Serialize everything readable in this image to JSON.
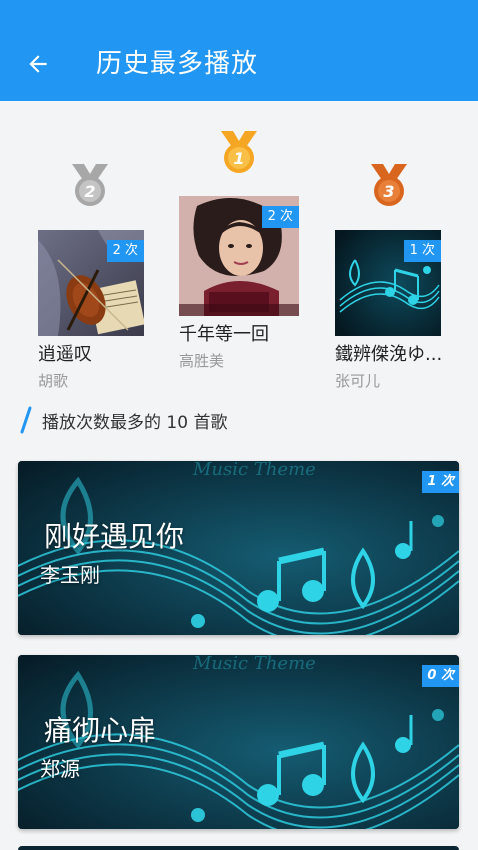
{
  "header": {
    "title": "历史最多播放",
    "back_icon": "arrow-left-icon",
    "background": "#2196f3"
  },
  "podium": {
    "first": {
      "rank": "1",
      "title": "千年等一回",
      "artist": "高胜美",
      "count": "2 次",
      "medal_color": "#f5a623"
    },
    "second": {
      "rank": "2",
      "title": "逍遥叹",
      "artist": "胡歌",
      "count": "2 次",
      "medal_color": "#a7a7a7"
    },
    "third": {
      "rank": "3",
      "title": "鐵辨傑浼ゆ...",
      "artist": "张可儿",
      "count": "1 次",
      "medal_color": "#d9661f"
    }
  },
  "section": {
    "title": "播放次数最多的 10 首歌"
  },
  "cards": [
    {
      "title": "刚好遇见你",
      "artist": "李玉刚",
      "count": "1 次"
    },
    {
      "title": "痛彻心扉",
      "artist": "郑源",
      "count": "0 次"
    }
  ],
  "colors": {
    "accent": "#2196f3",
    "card_bg": "#0b2533",
    "music_teal": "#2fd3e6"
  }
}
